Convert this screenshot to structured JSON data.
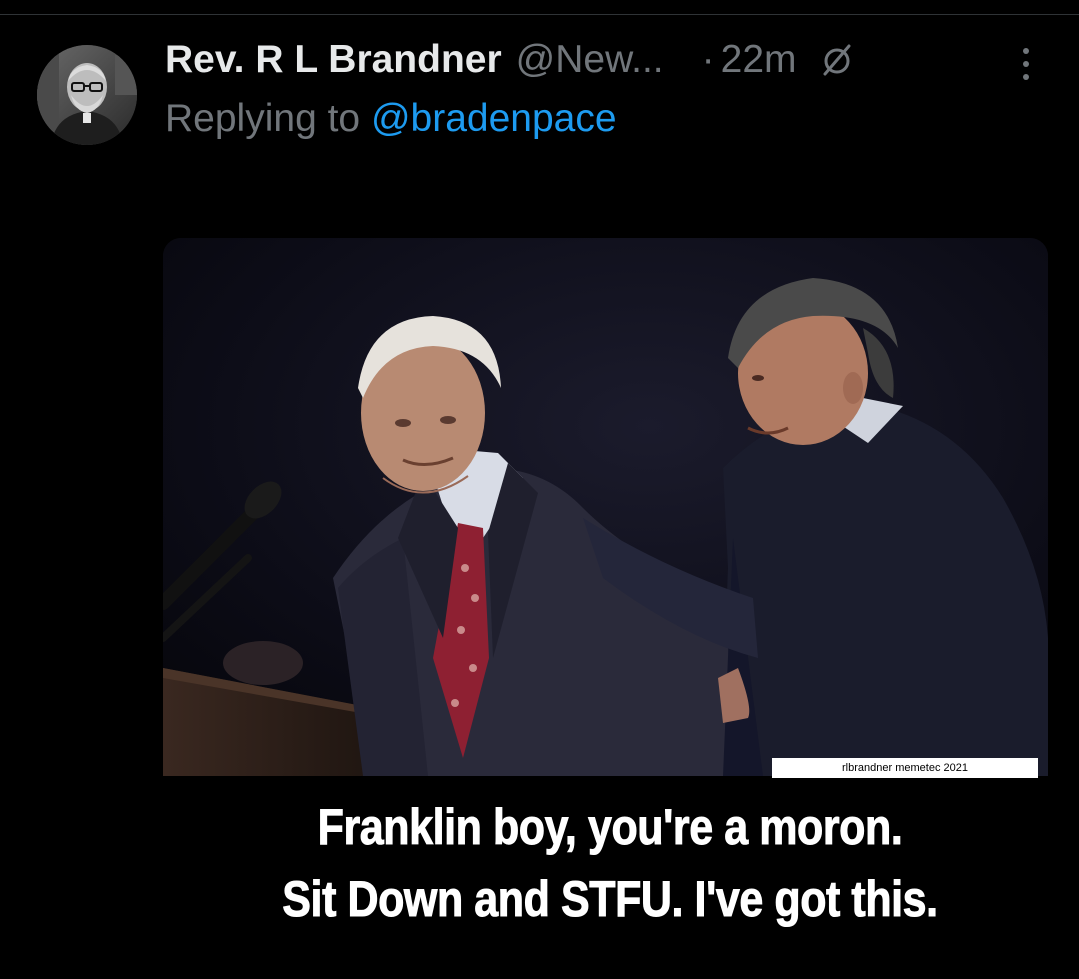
{
  "tweet": {
    "display_name": "Rev. R L Brandner",
    "handle": "@New...",
    "separator": "·",
    "timestamp": "22m",
    "edited_icon": "edited-pencil-icon",
    "more_icon": "more-options-icon",
    "reply_prefix": "Replying to",
    "reply_to": "@bradenpace"
  },
  "media": {
    "watermark": "rlbrandner memetec 2021",
    "caption_line_1": "Franklin boy, you're a moron.",
    "caption_line_2": "Sit Down and STFU. I've got this."
  },
  "colors": {
    "background": "#000000",
    "primary_text": "#e7e9ea",
    "secondary_text": "#71767b",
    "link": "#1d9bf0",
    "caption_text": "#ffffff"
  }
}
